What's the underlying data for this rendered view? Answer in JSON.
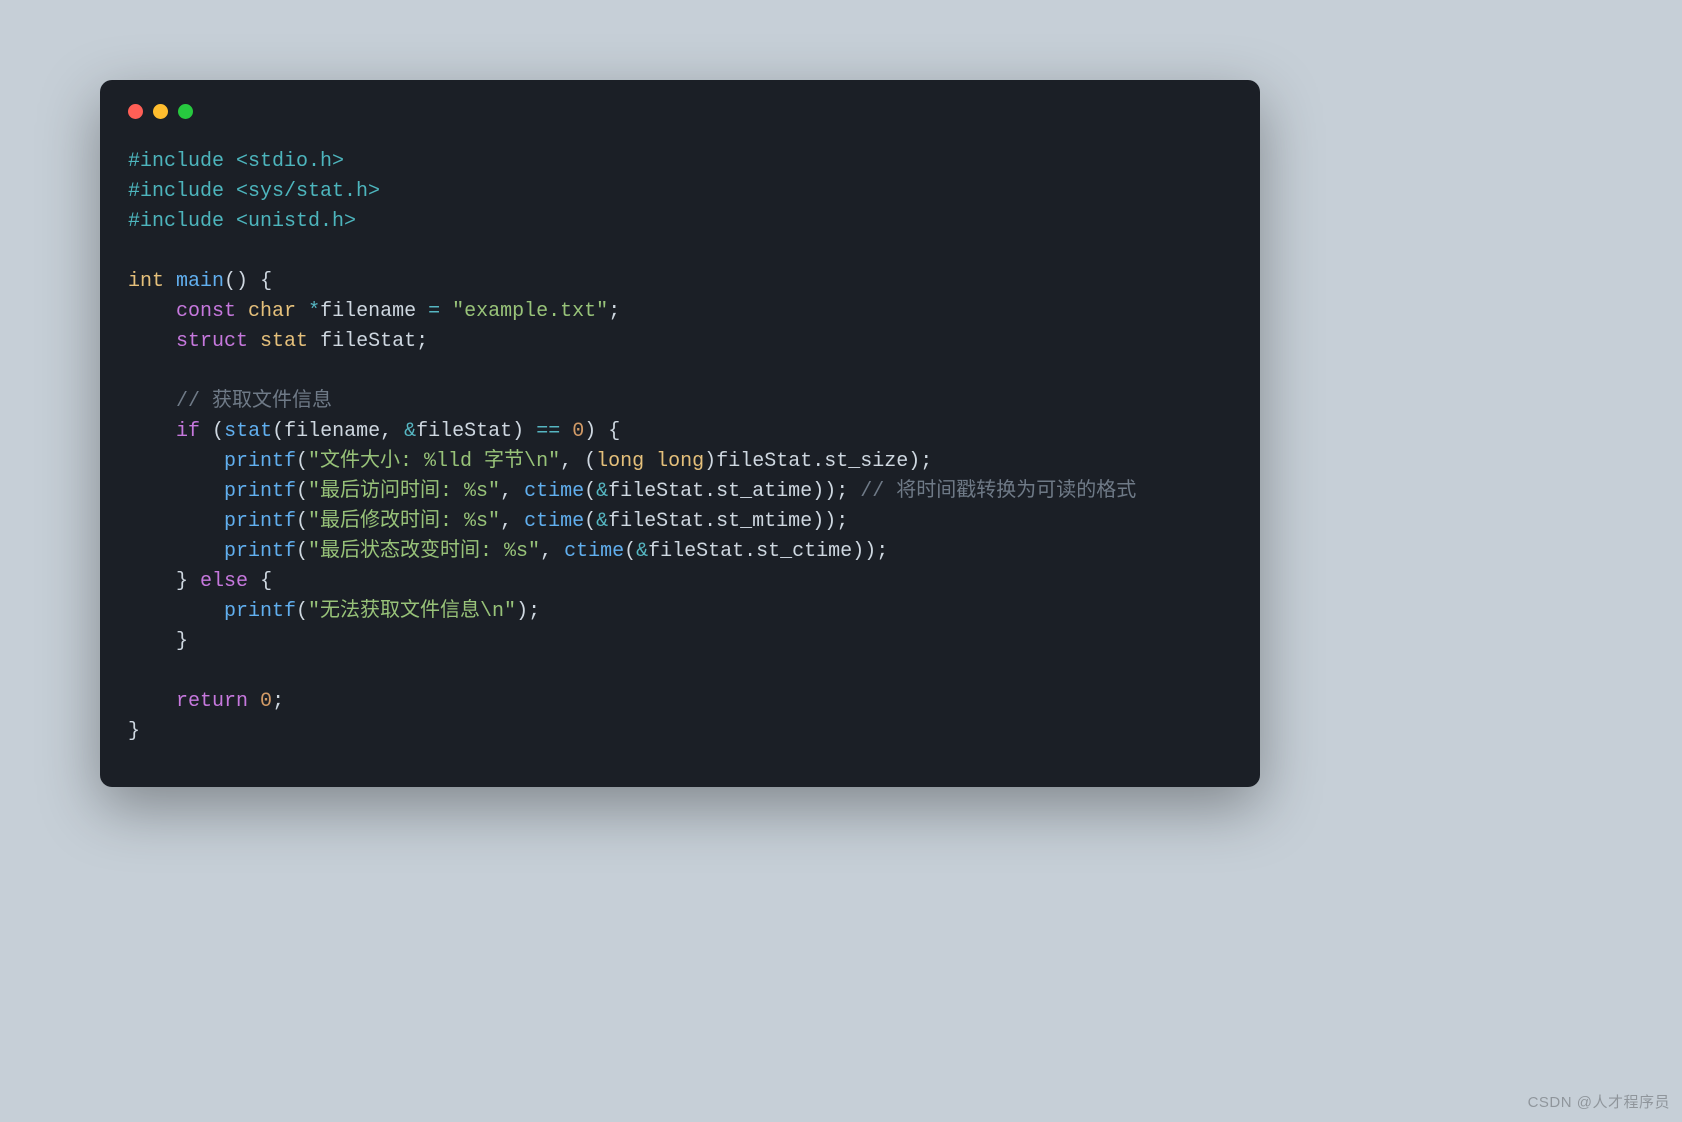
{
  "watermark": "CSDN @人才程序员",
  "window": {
    "traffic_lights": [
      "red",
      "yellow",
      "green"
    ]
  },
  "colors": {
    "bg_page": "#c6cfd7",
    "bg_window": "#1b1f26",
    "preprocessor": "#4db5bd",
    "keyword": "#c678dd",
    "type": "#e5c07b",
    "function": "#61afef",
    "string": "#98c379",
    "number": "#d19a66",
    "operator": "#56b6c2",
    "comment": "#6f7a87",
    "text": "#ced7e0"
  },
  "code": {
    "includes": [
      {
        "directive": "#include",
        "header": "<stdio.h>"
      },
      {
        "directive": "#include",
        "header": "<sys/stat.h>"
      },
      {
        "directive": "#include",
        "header": "<unistd.h>"
      }
    ],
    "fn_ret_type": "int",
    "fn_name": "main",
    "decl_const": "const",
    "decl_char": "char",
    "decl_struct": "struct",
    "decl_stat": "stat",
    "var_filename": "filename",
    "var_fileStat": "fileStat",
    "filename_literal": "\"example.txt\"",
    "comment_get_info": "// 获取文件信息",
    "stat_fn": "stat",
    "printf": "printf",
    "ctime": "ctime",
    "long_long": "long",
    "printf_size_fmt": "\"文件大小: %lld 字节\\n\"",
    "printf_atime_fmt": "\"最后访问时间: %s\"",
    "printf_mtime_fmt": "\"最后修改时间: %s\"",
    "printf_ctime_fmt": "\"最后状态改变时间: %s\"",
    "printf_err_fmt": "\"无法获取文件信息\\n\"",
    "comment_ctime": "// 将时间戳转换为可读的格式",
    "st_size": "st_size",
    "st_atime": "st_atime",
    "st_mtime": "st_mtime",
    "st_ctime": "st_ctime",
    "kw_if": "if",
    "kw_else": "else",
    "kw_return": "return",
    "zero": "0"
  }
}
